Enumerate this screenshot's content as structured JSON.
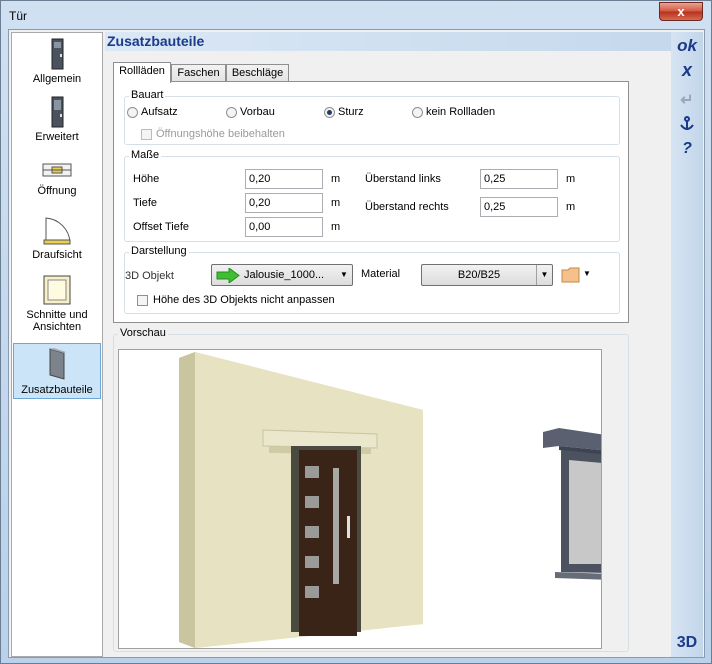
{
  "window": {
    "title": "Tür",
    "close_label": "x"
  },
  "sidebar": {
    "items": [
      {
        "label": "Allgemein",
        "icon": "door-icon"
      },
      {
        "label": "Erweitert",
        "icon": "door-extended-icon"
      },
      {
        "label": "Öffnung",
        "icon": "opening-icon"
      },
      {
        "label": "Draufsicht",
        "icon": "top-view-icon"
      },
      {
        "label": "Schnitte und Ansichten",
        "icon": "sections-icon"
      },
      {
        "label": "Zusatzbauteile",
        "icon": "additional-parts-icon",
        "selected": true
      }
    ]
  },
  "header": {
    "title": "Zusatzbauteile"
  },
  "tabs": [
    {
      "label": "Rollläden",
      "selected": true
    },
    {
      "label": "Faschen"
    },
    {
      "label": "Beschläge"
    }
  ],
  "bauart": {
    "label": "Bauart",
    "options": [
      "Aufsatz",
      "Vorbau",
      "Sturz",
      "kein Rollladen"
    ],
    "selected": "Sturz",
    "keep_height_label": "Öffnungshöhe beibehalten"
  },
  "masse": {
    "label": "Maße",
    "hoehe_label": "Höhe",
    "hoehe_value": "0,20",
    "tiefe_label": "Tiefe",
    "tiefe_value": "0,20",
    "offset_label": "Offset Tiefe",
    "offset_value": "0,00",
    "links_label": "Überstand links",
    "links_value": "0,25",
    "rechts_label": "Überstand rechts",
    "rechts_value": "0,25",
    "unit": "m"
  },
  "darstellung": {
    "label": "Darstellung",
    "object_label": "3D Objekt",
    "object_value": "Jalousie_1000...",
    "material_label": "Material",
    "material_value": "B20/B25",
    "no_adjust_label": "Höhe des 3D Objekts nicht anpassen"
  },
  "preview": {
    "label": "Vorschau"
  },
  "rightbar": {
    "ok": "ok",
    "cancel": "x",
    "help": "?",
    "threed": "3D"
  },
  "colors": {
    "accent": "#1a3a8a",
    "wall": "#e7e3c2",
    "door": "#3a2418"
  }
}
